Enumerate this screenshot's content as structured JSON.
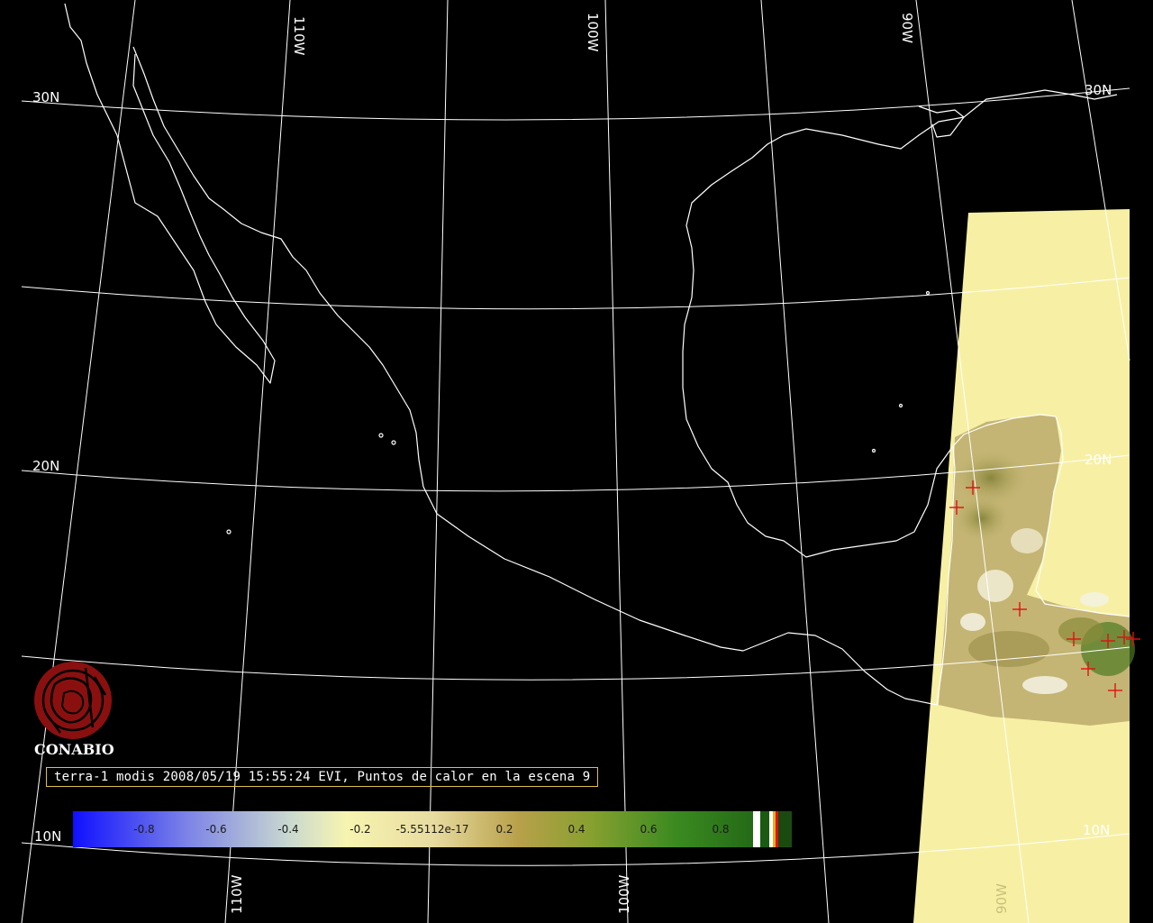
{
  "map": {
    "grid_labels": {
      "lat_30_left": "30N",
      "lat_30_right": "30N",
      "lat_20_left": "20N",
      "lat_20_right": "20N",
      "lat_10_left": "10N",
      "lat_10_right": "10N",
      "lon_110_top": "110W",
      "lon_100_top": "100W",
      "lon_90_top": "90W",
      "lon_110_bottom": "110W",
      "lon_100_bottom": "100W",
      "lon_90_bottom": "90W"
    },
    "background_color": "#000000",
    "coast_color": "#ffffff",
    "swath_color": "#f7f0a4",
    "hotspot_color": "#e01010"
  },
  "logo": {
    "text": "CONABIO",
    "icon": "conabio-emblem-icon",
    "color": "#8a1010"
  },
  "caption": {
    "text": "terra-1 modis 2008/05/19 15:55:24 EVI, Puntos de calor en la escena 9"
  },
  "legend": {
    "ticks": [
      "-0.8",
      "-0.6",
      "-0.4",
      "-0.2",
      "-5.55112e-17",
      "0.2",
      "0.4",
      "0.6",
      "0.8"
    ]
  }
}
